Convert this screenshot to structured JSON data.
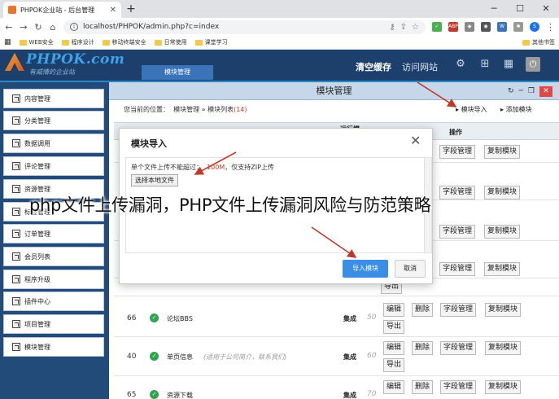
{
  "browser": {
    "tab_title": "PHPOK企业站 - 后台管理",
    "url": "localhost/PHPOK/admin.php?c=index",
    "bookmarks": [
      "WEB安全",
      "程序设计",
      "移动终端安全",
      "日常使用",
      "课堂学习"
    ],
    "other_bookmarks": "其他书签",
    "profile_initial": "S"
  },
  "header": {
    "logo": "PHPOK.com",
    "slogan": "有威情的企业站",
    "nav_item": "模块管理",
    "clear_cache": "清空缓存",
    "visit_site": "访问网站"
  },
  "sidebar": {
    "items": [
      "内容管理",
      "分类管理",
      "数据调用",
      "评论管理",
      "资源管理",
      "标签管理",
      "订单管理",
      "会员列表",
      "程序升级",
      "插件中心",
      "项目管理",
      "模块管理"
    ]
  },
  "main": {
    "window_title": "模块管理",
    "breadcrumb_prefix": "您当前的位置：",
    "breadcrumb_1": "模块管理",
    "breadcrumb_sep": "»",
    "breadcrumb_2": "模块列表",
    "count": "(14)",
    "import_link": "模块导入",
    "add_link": "添加模块",
    "col_run": "运行模",
    "col_op": "操作"
  },
  "rows": [
    {
      "buttons": [
        "删除",
        "字段管理",
        "复制模块"
      ]
    },
    {
      "buttons": [
        "字段管理",
        "复制模块"
      ]
    },
    {
      "buttons": [
        "删除",
        "字段管理",
        "复制模块"
      ]
    },
    {
      "buttons": [
        "字段管理",
        "复制模块"
      ]
    },
    {
      "buttons": [
        "导出"
      ]
    },
    {
      "id": "66",
      "name": "论坛BBS",
      "note": "",
      "type": "集成",
      "order": "50",
      "buttons": [
        "编辑",
        "删除",
        "字段管理",
        "复制模块",
        "导出"
      ]
    },
    {
      "id": "40",
      "name": "单页信息",
      "note": "(适用于公司简介，联系我们)",
      "type": "集成",
      "order": "60",
      "buttons": [
        "编辑",
        "删除",
        "字段管理",
        "复制模块",
        "导出"
      ]
    },
    {
      "id": "65",
      "name": "资源下载",
      "note": "",
      "type": "集成",
      "order": "70",
      "buttons": [
        "编辑",
        "删除",
        "字段管理",
        "复制模块"
      ]
    }
  ],
  "modal": {
    "title": "模块导入",
    "desc_prefix": "单个文件上传不能超过：",
    "desc_size": "100M",
    "desc_suffix": "，仅支持ZIP上传",
    "choose_button": "选择本地文件",
    "import_button": "导入模块",
    "cancel_button": "取消"
  },
  "overlay_caption": "php文件上传漏洞，PHP文件上传漏洞风险与防范策略",
  "colors": {
    "header_bg": "#1c3f6b",
    "sidebar_bg": "#234b7a",
    "accent": "#3a8ee6",
    "arrow": "#c0392b"
  }
}
